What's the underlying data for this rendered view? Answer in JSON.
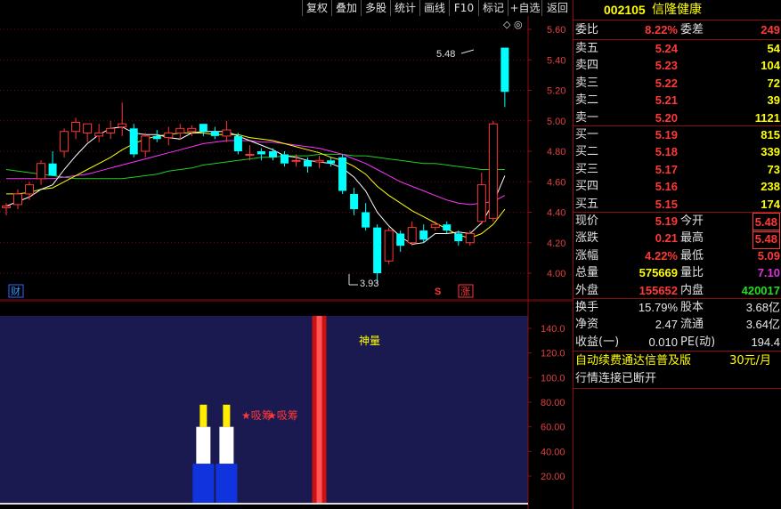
{
  "toolbar": {
    "buttons": [
      "复权",
      "叠加",
      "多股",
      "统计",
      "画线",
      "F10",
      "标记",
      "+自选",
      "返回"
    ]
  },
  "stock": {
    "code": "002105",
    "name": "信隆健康"
  },
  "order_book": {
    "wei_bi_label": "委比",
    "wei_bi": "8.22%",
    "wei_cha_label": "委差",
    "wei_cha": "249",
    "asks": [
      {
        "label": "卖五",
        "price": "5.24",
        "vol": "54"
      },
      {
        "label": "卖四",
        "price": "5.23",
        "vol": "104"
      },
      {
        "label": "卖三",
        "price": "5.22",
        "vol": "72"
      },
      {
        "label": "卖二",
        "price": "5.21",
        "vol": "39"
      },
      {
        "label": "卖一",
        "price": "5.20",
        "vol": "1121"
      }
    ],
    "bids": [
      {
        "label": "买一",
        "price": "5.19",
        "vol": "815"
      },
      {
        "label": "买二",
        "price": "5.18",
        "vol": "339"
      },
      {
        "label": "买三",
        "price": "5.17",
        "vol": "73"
      },
      {
        "label": "买四",
        "price": "5.16",
        "vol": "238"
      },
      {
        "label": "买五",
        "price": "5.15",
        "vol": "174"
      }
    ]
  },
  "quote": {
    "xianjia_label": "现价",
    "xianjia": "5.19",
    "jinkai_label": "今开",
    "jinkai": "5.48",
    "zhangdie_label": "涨跌",
    "zhangdie": "0.21",
    "zuigao_label": "最高",
    "zuigao": "5.48",
    "zhangfu_label": "涨幅",
    "zhangfu": "4.22%",
    "zuidi_label": "最低",
    "zuidi": "5.09",
    "zongliang_label": "总量",
    "zongliang": "575669",
    "liangbi_label": "量比",
    "liangbi": "7.10",
    "waipan_label": "外盘",
    "waipan": "155652",
    "neipan_label": "内盘",
    "neipan": "420017"
  },
  "fundamentals": {
    "huanshou_label": "换手",
    "huanshou": "15.79%",
    "guben_label": "股本",
    "guben": "3.68亿",
    "jingzi_label": "净资",
    "jingzi": "2.47",
    "liutong_label": "流通",
    "liutong": "3.64亿",
    "shouyi_label": "收益(一)",
    "shouyi": "0.010",
    "pe_label": "PE(动)",
    "pe": "194.4"
  },
  "notices": {
    "ad": "自动续费通达信普及版",
    "ad_price": "30元/月",
    "status": "行情连接已断开"
  },
  "main_chart": {
    "y_ticks": [
      "5.60",
      "5.40",
      "5.20",
      "5.00",
      "4.80",
      "4.60",
      "4.40",
      "4.20",
      "4.00"
    ],
    "high_label": "5.48",
    "low_label": "3.93",
    "marker_cai": "财",
    "marker_s": "S",
    "marker_zhang": "涨",
    "top_icon": "◇ ◎"
  },
  "sub_chart": {
    "y_ticks": [
      "140.0",
      "120.0",
      "100.0",
      "80.00",
      "60.00",
      "40.00",
      "20.00"
    ],
    "shenliang_label": "神量",
    "xichou_label": "吸筹"
  },
  "colors": {
    "up": "#ff3838",
    "down": "#00ffff",
    "ma5": "#ffffff",
    "ma10": "#ffff00",
    "ma20": "#ff33ff",
    "ma60": "#22cc22",
    "sub_bg": "#1a1a50"
  },
  "chart_data": {
    "type": "candlestick",
    "candles": [
      {
        "o": 4.43,
        "h": 4.46,
        "l": 4.38,
        "c": 4.44
      },
      {
        "o": 4.45,
        "h": 4.55,
        "l": 4.42,
        "c": 4.52
      },
      {
        "o": 4.52,
        "h": 4.6,
        "l": 4.48,
        "c": 4.58
      },
      {
        "o": 4.62,
        "h": 4.74,
        "l": 4.58,
        "c": 4.72
      },
      {
        "o": 4.72,
        "h": 4.8,
        "l": 4.66,
        "c": 4.64
      },
      {
        "o": 4.8,
        "h": 4.95,
        "l": 4.76,
        "c": 4.93
      },
      {
        "o": 4.93,
        "h": 5.02,
        "l": 4.88,
        "c": 4.99
      },
      {
        "o": 4.92,
        "h": 4.98,
        "l": 4.86,
        "c": 4.98
      },
      {
        "o": 4.9,
        "h": 4.98,
        "l": 4.86,
        "c": 4.92
      },
      {
        "o": 4.92,
        "h": 5.0,
        "l": 4.88,
        "c": 4.95
      },
      {
        "o": 4.96,
        "h": 5.12,
        "l": 4.9,
        "c": 4.98
      },
      {
        "o": 4.95,
        "h": 4.98,
        "l": 4.76,
        "c": 4.78
      },
      {
        "o": 4.8,
        "h": 4.92,
        "l": 4.76,
        "c": 4.9
      },
      {
        "o": 4.9,
        "h": 4.94,
        "l": 4.86,
        "c": 4.88
      },
      {
        "o": 4.89,
        "h": 4.96,
        "l": 4.84,
        "c": 4.92
      },
      {
        "o": 4.92,
        "h": 4.98,
        "l": 4.88,
        "c": 4.95
      },
      {
        "o": 4.93,
        "h": 4.97,
        "l": 4.9,
        "c": 4.95
      },
      {
        "o": 4.98,
        "h": 4.98,
        "l": 4.9,
        "c": 4.93
      },
      {
        "o": 4.93,
        "h": 4.96,
        "l": 4.88,
        "c": 4.9
      },
      {
        "o": 4.9,
        "h": 5.0,
        "l": 4.86,
        "c": 4.94
      },
      {
        "o": 4.9,
        "h": 4.92,
        "l": 4.78,
        "c": 4.8
      },
      {
        "o": 4.78,
        "h": 4.84,
        "l": 4.74,
        "c": 4.78
      },
      {
        "o": 4.8,
        "h": 4.82,
        "l": 4.74,
        "c": 4.78
      },
      {
        "o": 4.8,
        "h": 4.82,
        "l": 4.74,
        "c": 4.76
      },
      {
        "o": 4.78,
        "h": 4.8,
        "l": 4.7,
        "c": 4.72
      },
      {
        "o": 4.74,
        "h": 4.78,
        "l": 4.7,
        "c": 4.74
      },
      {
        "o": 4.74,
        "h": 4.76,
        "l": 4.66,
        "c": 4.7
      },
      {
        "o": 4.73,
        "h": 4.77,
        "l": 4.69,
        "c": 4.74
      },
      {
        "o": 4.74,
        "h": 4.76,
        "l": 4.7,
        "c": 4.72
      },
      {
        "o": 4.76,
        "h": 4.78,
        "l": 4.52,
        "c": 4.54
      },
      {
        "o": 4.52,
        "h": 4.56,
        "l": 4.38,
        "c": 4.42
      },
      {
        "o": 4.4,
        "h": 4.46,
        "l": 4.28,
        "c": 4.3
      },
      {
        "o": 4.3,
        "h": 4.32,
        "l": 3.93,
        "c": 4.0
      },
      {
        "o": 4.08,
        "h": 4.3,
        "l": 4.06,
        "c": 4.28
      },
      {
        "o": 4.26,
        "h": 4.28,
        "l": 4.14,
        "c": 4.18
      },
      {
        "o": 4.2,
        "h": 4.34,
        "l": 4.18,
        "c": 4.3
      },
      {
        "o": 4.28,
        "h": 4.32,
        "l": 4.2,
        "c": 4.22
      },
      {
        "o": 4.3,
        "h": 4.34,
        "l": 4.28,
        "c": 4.32
      },
      {
        "o": 4.32,
        "h": 4.34,
        "l": 4.26,
        "c": 4.28
      },
      {
        "o": 4.26,
        "h": 4.28,
        "l": 4.18,
        "c": 4.21
      },
      {
        "o": 4.2,
        "h": 4.28,
        "l": 4.18,
        "c": 4.26
      },
      {
        "o": 4.34,
        "h": 4.66,
        "l": 4.32,
        "c": 4.58
      },
      {
        "o": 4.36,
        "h": 5.0,
        "l": 4.34,
        "c": 4.98
      },
      {
        "o": 5.48,
        "h": 5.48,
        "l": 5.09,
        "c": 5.19
      }
    ],
    "ma5": [
      4.44,
      4.47,
      4.5,
      4.55,
      4.58,
      4.68,
      4.77,
      4.85,
      4.91,
      4.95,
      4.96,
      4.92,
      4.91,
      4.91,
      4.89,
      4.88,
      4.92,
      4.93,
      4.93,
      4.93,
      4.9,
      4.87,
      4.84,
      4.81,
      4.77,
      4.76,
      4.74,
      4.73,
      4.72,
      4.69,
      4.63,
      4.54,
      4.4,
      4.31,
      4.24,
      4.19,
      4.2,
      4.26,
      4.26,
      4.27,
      4.26,
      4.33,
      4.46,
      4.64
    ],
    "ma10": [
      4.52,
      4.52,
      4.53,
      4.55,
      4.56,
      4.6,
      4.64,
      4.68,
      4.72,
      4.76,
      4.81,
      4.85,
      4.88,
      4.9,
      4.91,
      4.92,
      4.92,
      4.92,
      4.91,
      4.91,
      4.91,
      4.89,
      4.88,
      4.87,
      4.85,
      4.83,
      4.81,
      4.79,
      4.76,
      4.74,
      4.7,
      4.65,
      4.57,
      4.51,
      4.46,
      4.41,
      4.37,
      4.33,
      4.29,
      4.25,
      4.23,
      4.26,
      4.32,
      4.42
    ],
    "ma20": [
      4.62,
      4.62,
      4.62,
      4.62,
      4.62,
      4.63,
      4.64,
      4.65,
      4.67,
      4.69,
      4.71,
      4.73,
      4.75,
      4.77,
      4.79,
      4.81,
      4.83,
      4.85,
      4.86,
      4.87,
      4.87,
      4.87,
      4.86,
      4.86,
      4.85,
      4.84,
      4.83,
      4.82,
      4.8,
      4.78,
      4.75,
      4.72,
      4.68,
      4.64,
      4.6,
      4.57,
      4.54,
      4.51,
      4.48,
      4.46,
      4.45,
      4.46,
      4.47,
      4.51
    ],
    "ma60": [
      4.68,
      4.67,
      4.66,
      4.65,
      4.64,
      4.63,
      4.62,
      4.62,
      4.62,
      4.62,
      4.62,
      4.63,
      4.64,
      4.65,
      4.67,
      4.68,
      4.69,
      4.71,
      4.72,
      4.73,
      4.74,
      4.75,
      4.76,
      4.76,
      4.77,
      4.77,
      4.77,
      4.78,
      4.78,
      4.78,
      4.77,
      4.77,
      4.76,
      4.75,
      4.74,
      4.73,
      4.72,
      4.72,
      4.71,
      4.7,
      4.69,
      4.68,
      4.68,
      4.68
    ],
    "sub_bars": [
      {
        "index": 17,
        "type": "xichou",
        "white_top": 60,
        "yellow_top": 78,
        "blue_top": 30
      },
      {
        "index": 19,
        "type": "xichou",
        "white_top": 60,
        "yellow_top": 78,
        "blue_top": 30
      },
      {
        "index": 27,
        "type": "shenliang",
        "value": 150
      }
    ],
    "ylim": [
      3.9,
      5.65
    ],
    "sub_ylim": [
      0,
      150
    ]
  }
}
